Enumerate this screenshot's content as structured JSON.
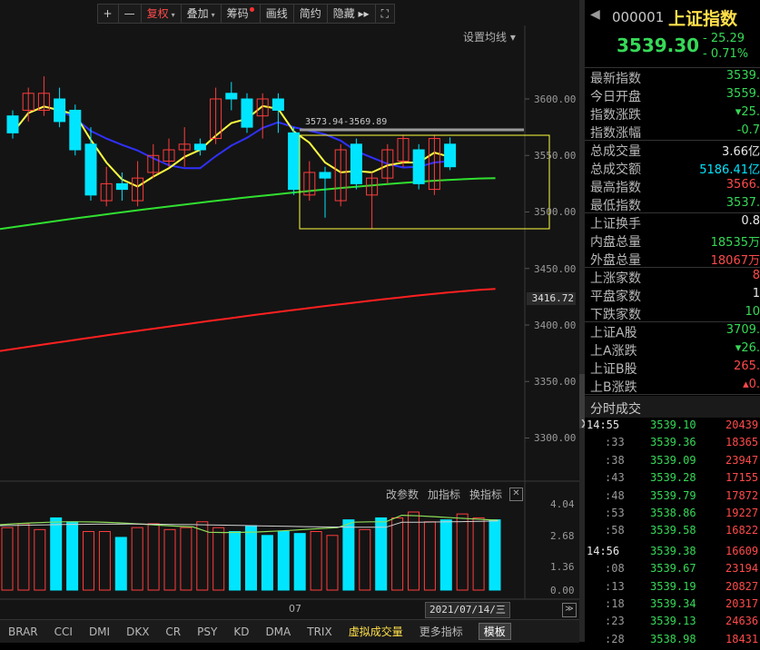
{
  "toolbar": {
    "items": [
      {
        "label": "+",
        "name": "zoom-in-button"
      },
      {
        "label": "—",
        "name": "zoom-out-button"
      },
      {
        "label": "复权",
        "name": "adjust-dropdown",
        "dropdown": true,
        "active": true
      },
      {
        "label": "叠加",
        "name": "overlay-dropdown",
        "dropdown": true
      },
      {
        "label": "筹码",
        "name": "chips-button",
        "dot": true
      },
      {
        "label": "画线",
        "name": "draw-line-button"
      },
      {
        "label": "简约",
        "name": "simple-mode-button"
      },
      {
        "label": "隐藏 ▸▸",
        "name": "hide-button"
      },
      {
        "label": "⛶",
        "name": "fullscreen-icon"
      }
    ]
  },
  "main_chart": {
    "ma_settings_label": "设置均线 ▾",
    "range_label": "3573.94-3569.89",
    "current_value_flag": "3416.72",
    "y_ticks": [
      "3600.00",
      "3550.00",
      "3500.00",
      "3450.00",
      "3400.00",
      "3350.00",
      "3300.00"
    ]
  },
  "volume_panel": {
    "tools": [
      "改参数",
      "加指标",
      "换指标"
    ],
    "close_label": "✕",
    "y_ticks": [
      "4.04",
      "2.68",
      "1.36",
      "0.00"
    ]
  },
  "x_axis": {
    "month_label": "07",
    "date_flag": "2021/07/14/三",
    "next_label": "≫"
  },
  "indicator_tabs": [
    "BRAR",
    "CCI",
    "DMI",
    "DKX",
    "CR",
    "PSY",
    "KD",
    "DMA",
    "TRIX",
    "虚拟成交量",
    "更多指标",
    "模板"
  ],
  "indicator_active": "虚拟成交量",
  "chart_data": {
    "type": "candlestick",
    "y_axis_range": [
      3280,
      3640
    ],
    "colors": {
      "up": "#ff3c3c",
      "down": "#00e5ff",
      "ma_yellow": "#ffff40",
      "ma_blue": "#3030ff",
      "ma_green": "#30e030",
      "ma_red": "#ff2020"
    },
    "candles": [
      {
        "o": 3585,
        "c": 3570,
        "h": 3590,
        "l": 3565
      },
      {
        "o": 3590,
        "c": 3605,
        "h": 3610,
        "l": 3580
      },
      {
        "o": 3590,
        "c": 3605,
        "h": 3620,
        "l": 3585
      },
      {
        "o": 3600,
        "c": 3580,
        "h": 3610,
        "l": 3575
      },
      {
        "o": 3590,
        "c": 3555,
        "h": 3595,
        "l": 3550
      },
      {
        "o": 3560,
        "c": 3515,
        "h": 3575,
        "l": 3510
      },
      {
        "o": 3510,
        "c": 3525,
        "h": 3540,
        "l": 3505
      },
      {
        "o": 3525,
        "c": 3520,
        "h": 3535,
        "l": 3510
      },
      {
        "o": 3510,
        "c": 3530,
        "h": 3545,
        "l": 3505
      },
      {
        "o": 3535,
        "c": 3550,
        "h": 3560,
        "l": 3530
      },
      {
        "o": 3545,
        "c": 3555,
        "h": 3565,
        "l": 3540
      },
      {
        "o": 3555,
        "c": 3560,
        "h": 3575,
        "l": 3540
      },
      {
        "o": 3560,
        "c": 3555,
        "h": 3565,
        "l": 3550
      },
      {
        "o": 3565,
        "c": 3600,
        "h": 3610,
        "l": 3560
      },
      {
        "o": 3605,
        "c": 3600,
        "h": 3615,
        "l": 3590
      },
      {
        "o": 3600,
        "c": 3575,
        "h": 3605,
        "l": 3570
      },
      {
        "o": 3585,
        "c": 3600,
        "h": 3605,
        "l": 3565
      },
      {
        "o": 3600,
        "c": 3590,
        "h": 3605,
        "l": 3570
      },
      {
        "o": 3570,
        "c": 3520,
        "h": 3575,
        "l": 3515
      },
      {
        "o": 3515,
        "c": 3535,
        "h": 3545,
        "l": 3510
      },
      {
        "o": 3535,
        "c": 3530,
        "h": 3540,
        "l": 3495
      },
      {
        "o": 3510,
        "c": 3555,
        "h": 3560,
        "l": 3505
      },
      {
        "o": 3560,
        "c": 3525,
        "h": 3565,
        "l": 3520
      },
      {
        "o": 3515,
        "c": 3530,
        "h": 3535,
        "l": 3485
      },
      {
        "o": 3530,
        "c": 3555,
        "h": 3560,
        "l": 3525
      },
      {
        "o": 3545,
        "c": 3565,
        "h": 3568,
        "l": 3540
      },
      {
        "o": 3555,
        "c": 3525,
        "h": 3560,
        "l": 3520
      },
      {
        "o": 3520,
        "c": 3565,
        "h": 3568,
        "l": 3515
      },
      {
        "o": 3560,
        "c": 3540,
        "h": 3566,
        "l": 3537
      }
    ],
    "volume": [
      {
        "v": 3.2,
        "up": true
      },
      {
        "v": 3.4,
        "up": true
      },
      {
        "v": 3.1,
        "up": true
      },
      {
        "v": 3.7,
        "up": false
      },
      {
        "v": 3.5,
        "up": false
      },
      {
        "v": 3.0,
        "up": true
      },
      {
        "v": 3.0,
        "up": true
      },
      {
        "v": 2.7,
        "up": false
      },
      {
        "v": 3.2,
        "up": true
      },
      {
        "v": 3.4,
        "up": true
      },
      {
        "v": 3.1,
        "up": true
      },
      {
        "v": 3.2,
        "up": true
      },
      {
        "v": 3.5,
        "up": true
      },
      {
        "v": 3.2,
        "up": true
      },
      {
        "v": 3.0,
        "up": false
      },
      {
        "v": 3.3,
        "up": false
      },
      {
        "v": 2.8,
        "up": false
      },
      {
        "v": 3.0,
        "up": false
      },
      {
        "v": 2.9,
        "up": false
      },
      {
        "v": 3.0,
        "up": true
      },
      {
        "v": 2.8,
        "up": true
      },
      {
        "v": 3.6,
        "up": false
      },
      {
        "v": 3.1,
        "up": true
      },
      {
        "v": 3.7,
        "up": false
      },
      {
        "v": 3.7,
        "up": true
      },
      {
        "v": 4.0,
        "up": true
      },
      {
        "v": 3.5,
        "up": true
      },
      {
        "v": 3.6,
        "up": false
      },
      {
        "v": 3.9,
        "up": true
      },
      {
        "v": 3.7,
        "up": true
      },
      {
        "v": 3.6,
        "up": false
      }
    ]
  },
  "quote": {
    "code": "000001",
    "name": "上证指数",
    "price": "3539.30",
    "change": "- 25.29",
    "change_pct": "- 0.71%",
    "rows": [
      {
        "label": "最新指数",
        "value": "3539.",
        "color": "green"
      },
      {
        "label": "今日开盘",
        "value": "3559.",
        "color": "green"
      },
      {
        "label": "指数涨跌",
        "value": "▾25.",
        "color": "green"
      },
      {
        "label": "指数涨幅",
        "value": "-0.7",
        "color": "green"
      },
      {
        "label": "总成交量",
        "value": "3.66亿",
        "color": "white"
      },
      {
        "label": "总成交额",
        "value": "5186.41亿",
        "color": "cyan"
      },
      {
        "label": "最高指数",
        "value": "3566.",
        "color": "red"
      },
      {
        "label": "最低指数",
        "value": "3537.",
        "color": "green"
      },
      {
        "label": "上证换手",
        "value": "0.8",
        "color": "white"
      },
      {
        "label": "内盘总量",
        "value": "18535万",
        "color": "green"
      },
      {
        "label": "外盘总量",
        "value": "18067万",
        "color": "red"
      },
      {
        "label": "上涨家数",
        "value": "8",
        "color": "red"
      },
      {
        "label": "平盘家数",
        "value": "1",
        "color": "white"
      },
      {
        "label": "下跌家数",
        "value": "10",
        "color": "green"
      },
      {
        "label": "上证A股",
        "value": "3709.",
        "color": "green"
      },
      {
        "label": "上A涨跌",
        "value": "▾26.",
        "color": "green"
      },
      {
        "label": "上证B股",
        "value": "265.",
        "color": "red"
      },
      {
        "label": "上B涨跌",
        "value": "▴0.",
        "color": "red"
      }
    ]
  },
  "ticks": {
    "header": "分时成交",
    "rows": [
      {
        "time": "14:55",
        "price": "3539.10",
        "volume": "20439"
      },
      {
        "time": ":33",
        "price": "3539.36",
        "volume": "18365"
      },
      {
        "time": ":38",
        "price": "3539.09",
        "volume": "23947"
      },
      {
        "time": ":43",
        "price": "3539.28",
        "volume": "17155"
      },
      {
        "time": ":48",
        "price": "3539.79",
        "volume": "17872"
      },
      {
        "time": ":53",
        "price": "3538.86",
        "volume": "19227"
      },
      {
        "time": ":58",
        "price": "3539.58",
        "volume": "16822"
      },
      {
        "time": "14:56",
        "price": "3539.38",
        "volume": "16609"
      },
      {
        "time": ":08",
        "price": "3539.67",
        "volume": "23194"
      },
      {
        "time": ":13",
        "price": "3539.19",
        "volume": "20827"
      },
      {
        "time": ":18",
        "price": "3539.34",
        "volume": "20317"
      },
      {
        "time": ":23",
        "price": "3539.13",
        "volume": "24636"
      },
      {
        "time": ":28",
        "price": "3538.98",
        "volume": "18431"
      }
    ]
  }
}
